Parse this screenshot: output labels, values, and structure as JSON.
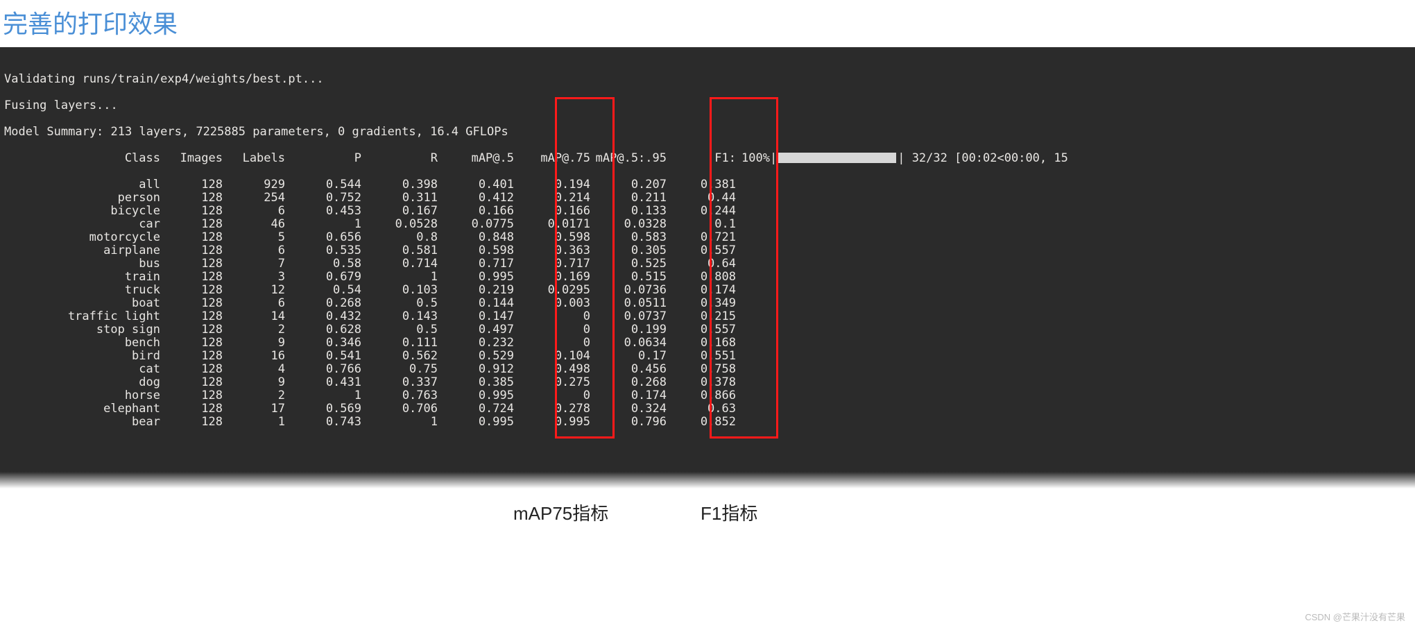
{
  "title": "完善的打印效果",
  "terminal": {
    "lines": [
      "Validating runs/train/exp4/weights/best.pt...",
      "Fusing layers... ",
      "Model Summary: 213 layers, 7225885 parameters, 0 gradients, 16.4 GFLOPs"
    ],
    "headers": {
      "class": "Class",
      "images": "Images",
      "labels": "Labels",
      "p": "P",
      "r": "R",
      "map5": "mAP@.5",
      "map75": "mAP@.75",
      "map595": "mAP@.5:.95",
      "f1": "F1:"
    },
    "progress": {
      "percent": "100%",
      "counter": " 32/32 [00:02<00:00, 15"
    },
    "rows": [
      {
        "class": "all",
        "images": "128",
        "labels": "929",
        "p": "0.544",
        "r": "0.398",
        "map5": "0.401",
        "map75": "0.194",
        "map595": "0.207",
        "f1": "0.381"
      },
      {
        "class": "person",
        "images": "128",
        "labels": "254",
        "p": "0.752",
        "r": "0.311",
        "map5": "0.412",
        "map75": "0.214",
        "map595": "0.211",
        "f1": "0.44"
      },
      {
        "class": "bicycle",
        "images": "128",
        "labels": "6",
        "p": "0.453",
        "r": "0.167",
        "map5": "0.166",
        "map75": "0.166",
        "map595": "0.133",
        "f1": "0.244"
      },
      {
        "class": "car",
        "images": "128",
        "labels": "46",
        "p": "1",
        "r": "0.0528",
        "map5": "0.0775",
        "map75": "0.0171",
        "map595": "0.0328",
        "f1": "0.1"
      },
      {
        "class": "motorcycle",
        "images": "128",
        "labels": "5",
        "p": "0.656",
        "r": "0.8",
        "map5": "0.848",
        "map75": "0.598",
        "map595": "0.583",
        "f1": "0.721"
      },
      {
        "class": "airplane",
        "images": "128",
        "labels": "6",
        "p": "0.535",
        "r": "0.581",
        "map5": "0.598",
        "map75": "0.363",
        "map595": "0.305",
        "f1": "0.557"
      },
      {
        "class": "bus",
        "images": "128",
        "labels": "7",
        "p": "0.58",
        "r": "0.714",
        "map5": "0.717",
        "map75": "0.717",
        "map595": "0.525",
        "f1": "0.64"
      },
      {
        "class": "train",
        "images": "128",
        "labels": "3",
        "p": "0.679",
        "r": "1",
        "map5": "0.995",
        "map75": "0.169",
        "map595": "0.515",
        "f1": "0.808"
      },
      {
        "class": "truck",
        "images": "128",
        "labels": "12",
        "p": "0.54",
        "r": "0.103",
        "map5": "0.219",
        "map75": "0.0295",
        "map595": "0.0736",
        "f1": "0.174"
      },
      {
        "class": "boat",
        "images": "128",
        "labels": "6",
        "p": "0.268",
        "r": "0.5",
        "map5": "0.144",
        "map75": "0.003",
        "map595": "0.0511",
        "f1": "0.349"
      },
      {
        "class": "traffic light",
        "images": "128",
        "labels": "14",
        "p": "0.432",
        "r": "0.143",
        "map5": "0.147",
        "map75": "0",
        "map595": "0.0737",
        "f1": "0.215"
      },
      {
        "class": "stop sign",
        "images": "128",
        "labels": "2",
        "p": "0.628",
        "r": "0.5",
        "map5": "0.497",
        "map75": "0",
        "map595": "0.199",
        "f1": "0.557"
      },
      {
        "class": "bench",
        "images": "128",
        "labels": "9",
        "p": "0.346",
        "r": "0.111",
        "map5": "0.232",
        "map75": "0",
        "map595": "0.0634",
        "f1": "0.168"
      },
      {
        "class": "bird",
        "images": "128",
        "labels": "16",
        "p": "0.541",
        "r": "0.562",
        "map5": "0.529",
        "map75": "0.104",
        "map595": "0.17",
        "f1": "0.551"
      },
      {
        "class": "cat",
        "images": "128",
        "labels": "4",
        "p": "0.766",
        "r": "0.75",
        "map5": "0.912",
        "map75": "0.498",
        "map595": "0.456",
        "f1": "0.758"
      },
      {
        "class": "dog",
        "images": "128",
        "labels": "9",
        "p": "0.431",
        "r": "0.337",
        "map5": "0.385",
        "map75": "0.275",
        "map595": "0.268",
        "f1": "0.378"
      },
      {
        "class": "horse",
        "images": "128",
        "labels": "2",
        "p": "1",
        "r": "0.763",
        "map5": "0.995",
        "map75": "0",
        "map595": "0.174",
        "f1": "0.866"
      },
      {
        "class": "elephant",
        "images": "128",
        "labels": "17",
        "p": "0.569",
        "r": "0.706",
        "map5": "0.724",
        "map75": "0.278",
        "map595": "0.324",
        "f1": "0.63"
      },
      {
        "class": "bear",
        "images": "128",
        "labels": "1",
        "p": "0.743",
        "r": "1",
        "map5": "0.995",
        "map75": "0.995",
        "map595": "0.796",
        "f1": "0.852"
      }
    ]
  },
  "annotations": {
    "map75": "mAP75指标",
    "f1": "F1指标"
  },
  "watermark": "CSDN @芒果汁没有芒果"
}
